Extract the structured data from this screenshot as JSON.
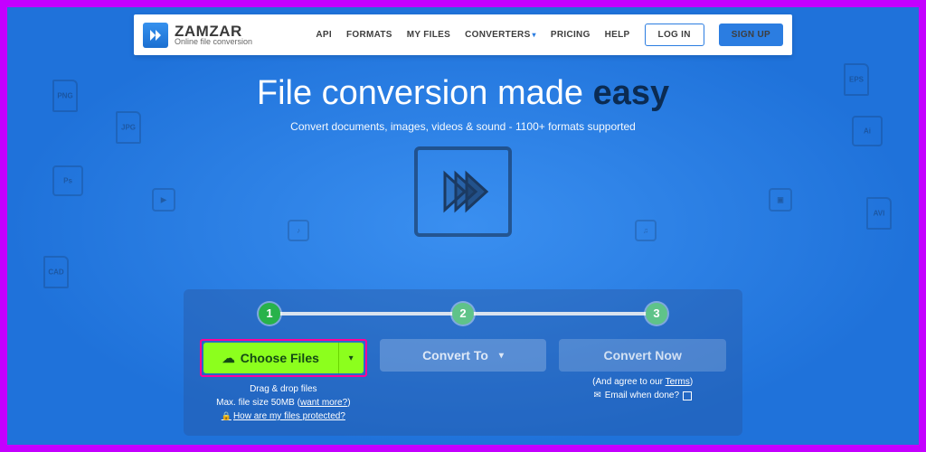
{
  "brand": {
    "name": "ZAMZAR",
    "tagline": "Online file conversion"
  },
  "nav": {
    "api": "API",
    "formats": "FORMATS",
    "myfiles": "MY FILES",
    "converters": "CONVERTERS",
    "pricing": "PRICING",
    "help": "HELP",
    "login": "LOG IN",
    "signup": "SIGN UP"
  },
  "hero": {
    "title_pre": "File conversion made ",
    "title_em": "easy",
    "sub": "Convert documents, images, videos & sound - 1100+ formats supported"
  },
  "steps": [
    "1",
    "2",
    "3"
  ],
  "actions": {
    "choose": "Choose Files",
    "convert": "Convert To",
    "now": "Convert Now"
  },
  "hints": {
    "drag": "Drag & drop files",
    "max_pre": "Max. file size 50MB (",
    "max_link": "want more?",
    "max_post": ")",
    "protected": "How are my files protected?"
  },
  "terms": {
    "pre": "(And agree to our ",
    "link": "Terms",
    "post": ")"
  },
  "email": "Email when done?"
}
